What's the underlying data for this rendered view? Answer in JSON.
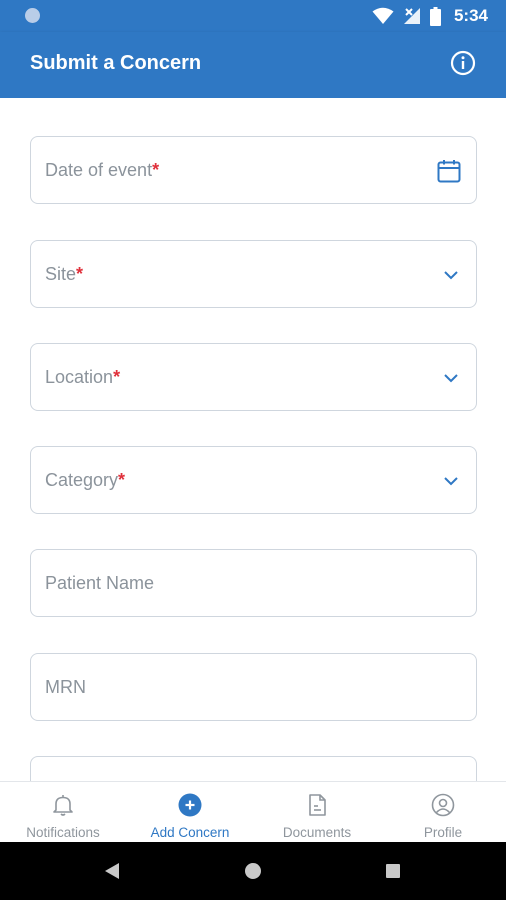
{
  "status_bar": {
    "time": "5:34"
  },
  "app_bar": {
    "title": "Submit a Concern",
    "info_icon": "info-circle-icon"
  },
  "form": {
    "required_marker": "*",
    "fields": [
      {
        "label": "Date of event",
        "required": true,
        "icon": "calendar-icon"
      },
      {
        "label": "Site",
        "required": true,
        "icon": "chevron-down-icon"
      },
      {
        "label": "Location",
        "required": true,
        "icon": "chevron-down-icon"
      },
      {
        "label": "Category",
        "required": true,
        "icon": "chevron-down-icon"
      },
      {
        "label": "Patient Name",
        "required": false
      },
      {
        "label": "MRN",
        "required": false
      }
    ]
  },
  "bottom_nav": {
    "items": [
      {
        "label": "Notifications",
        "icon": "bell-icon",
        "active": false
      },
      {
        "label": "Add Concern",
        "icon": "add-circle-icon",
        "active": true
      },
      {
        "label": "Documents",
        "icon": "document-icon",
        "active": false
      },
      {
        "label": "Profile",
        "icon": "profile-icon",
        "active": false
      }
    ]
  },
  "colors": {
    "primary": "#2f78c4",
    "required": "#e0303b",
    "label": "#8b939b",
    "border": "#cfd6de",
    "nav_inactive": "#8f969d"
  }
}
